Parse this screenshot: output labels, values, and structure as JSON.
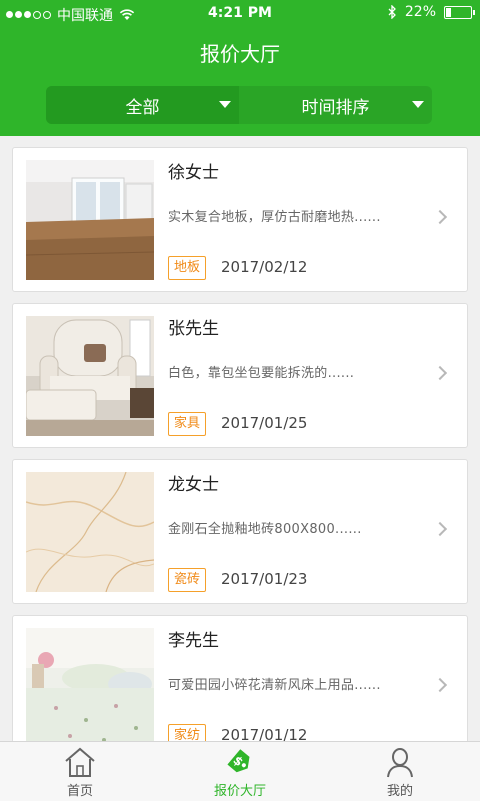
{
  "status": {
    "carrier": "中国联通",
    "time": "4:21 PM",
    "battery": "22%",
    "battery_level": 0.22
  },
  "header": {
    "title": "报价大厅"
  },
  "filters": [
    {
      "label": "全部",
      "selected": true
    },
    {
      "label": "时间排序",
      "selected": false
    }
  ],
  "quotes": [
    {
      "name": "徐女士",
      "desc": "实木复合地板，厚仿古耐磨地热......",
      "tag": "地板",
      "date": "2017/02/12",
      "image": "room-photo"
    },
    {
      "name": "张先生",
      "desc": "白色，靠包坐包要能拆洗的......",
      "tag": "家具",
      "date": "2017/01/25",
      "image": "armchair-photo"
    },
    {
      "name": "龙女士",
      "desc": "金刚石全抛釉地砖800X800......",
      "tag": "瓷砖",
      "date": "2017/01/23",
      "image": "marble-photo"
    },
    {
      "name": "李先生",
      "desc": "可爱田园小碎花清新风床上用品......",
      "tag": "家纺",
      "date": "2017/01/12",
      "image": "bedding-photo"
    }
  ],
  "tabbar": [
    {
      "label": "首页",
      "icon": "home-icon",
      "active": false
    },
    {
      "label": "报价大厅",
      "icon": "price-tag-icon",
      "active": true
    },
    {
      "label": "我的",
      "icon": "person-icon",
      "active": false
    }
  ],
  "colors": {
    "brand_green": "#2fb52a",
    "tag_orange": "#f08a17",
    "background": "#f0f0f0"
  }
}
